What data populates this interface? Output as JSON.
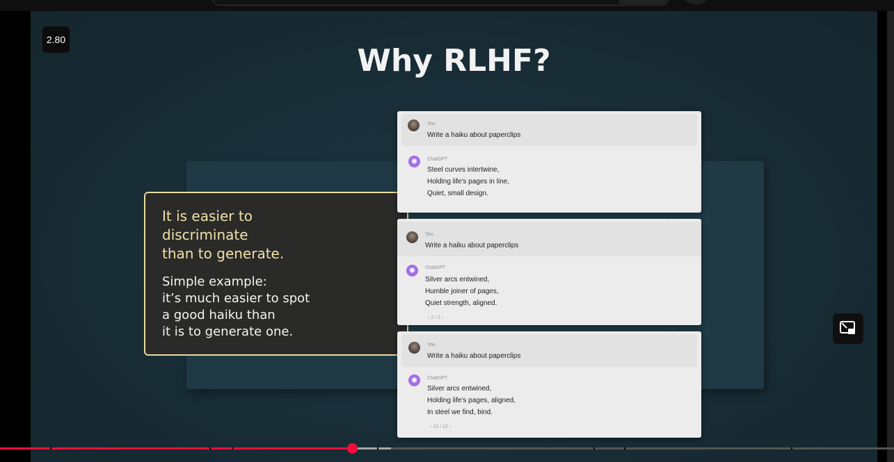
{
  "player": {
    "speed_badge": "2.80",
    "progress_fraction": 0.394,
    "loaded_fraction": 0.437
  },
  "slide": {
    "title": "Why RLHF?",
    "callout": {
      "heading": "It is easier to\ndiscriminate\nthan to generate.",
      "body": "Simple example:\nit’s much easier to spot\na good haiku than\nit is to generate one."
    },
    "chats": [
      {
        "user_name": "You",
        "prompt": "Write a haiku about paperclips",
        "bot_name": "ChatGPT",
        "reply": [
          "Steel curves intertwine,",
          "Holding life's pages in line,",
          "Quiet, small design."
        ],
        "pager": ""
      },
      {
        "user_name": "You",
        "prompt": "Write a haiku about paperclips",
        "bot_name": "ChatGPT",
        "reply": [
          "Silver arcs entwined,",
          "Humble joiner of pages,",
          "Quiet strength, aligned."
        ],
        "pager": "‹ 2 / 2 ›"
      },
      {
        "user_name": "You",
        "prompt": "Write a haiku about paperclips",
        "bot_name": "ChatGPT",
        "reply": [
          "Silver arcs entwined,",
          "Holding life's pages, aligned,",
          "In steel we find, bind."
        ],
        "pager": "‹ 12 / 12 ›"
      }
    ]
  },
  "icons": {
    "chat_bot": "openai-icon",
    "user": "user-avatar",
    "pip": "miniplayer-icon"
  },
  "colors": {
    "progress": "#f00f3c",
    "callout_border": "#e8dca0",
    "callout_heading": "#efe2a8",
    "bot_icon": "#a26ee6"
  }
}
